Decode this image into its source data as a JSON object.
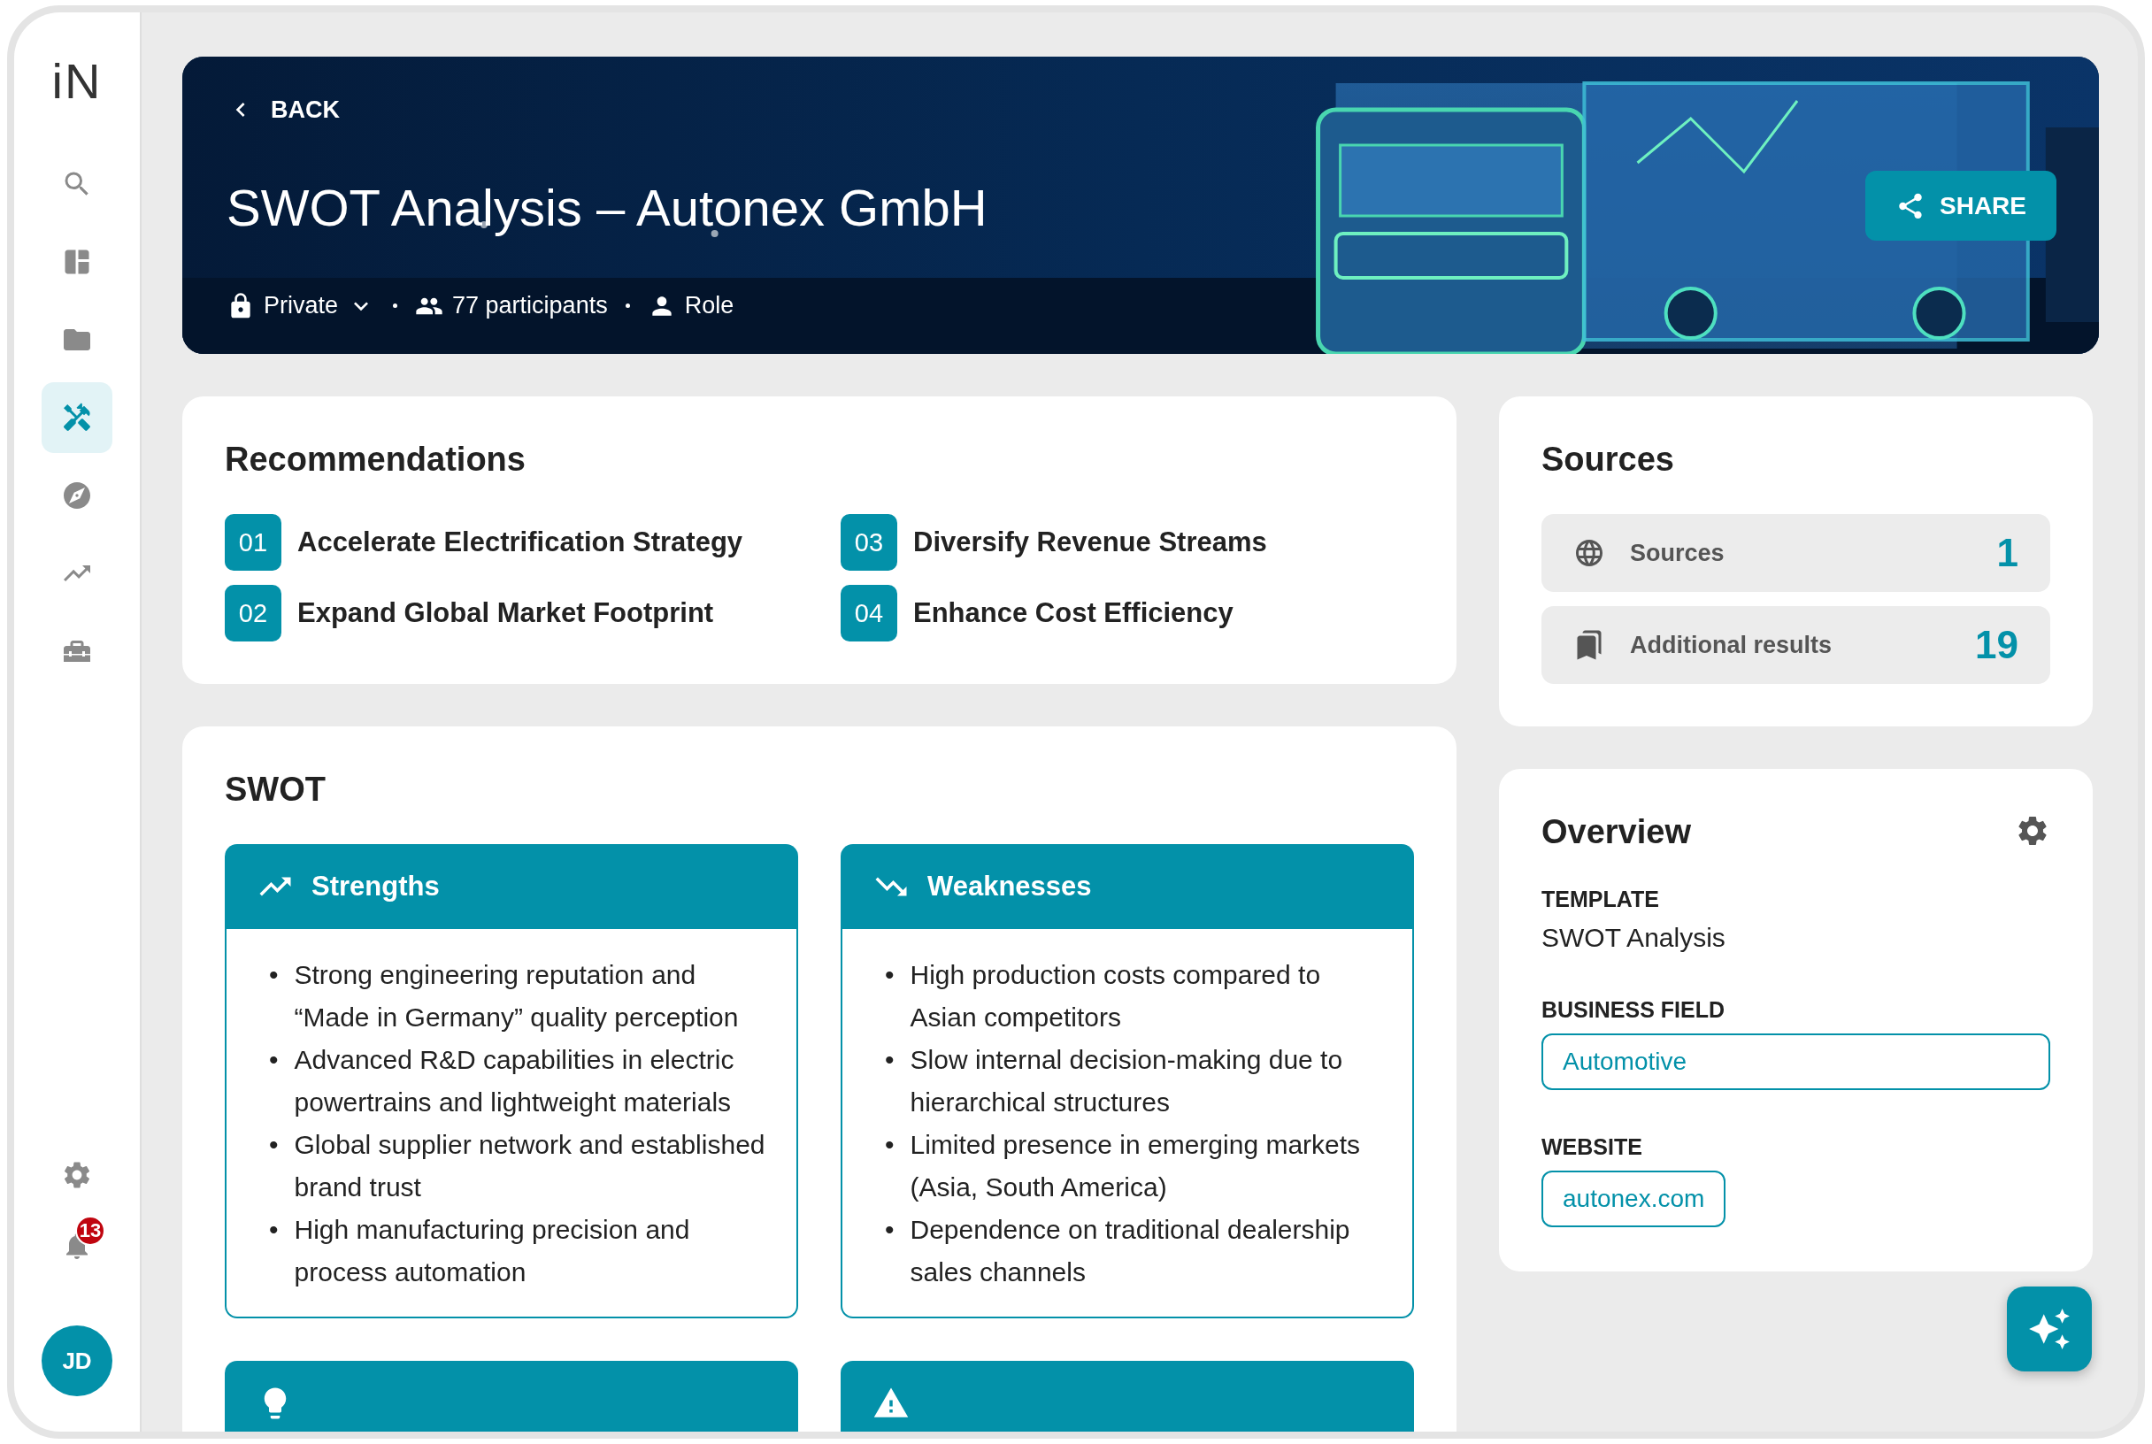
{
  "sidebar": {
    "logo": "iN",
    "nav": [
      {
        "kind": "search",
        "selected": false
      },
      {
        "kind": "dashboard",
        "selected": false
      },
      {
        "kind": "folder",
        "selected": false
      },
      {
        "kind": "tools",
        "selected": true
      },
      {
        "kind": "compass",
        "selected": false
      },
      {
        "kind": "trend",
        "selected": false
      },
      {
        "kind": "toolbox",
        "selected": false
      }
    ],
    "notifications": "13",
    "avatar": "JD"
  },
  "header": {
    "back": "BACK",
    "title": "SWOT Analysis – Autonex GmbH",
    "privacy": "Private",
    "participants": "77 participants",
    "role": "Role",
    "share": "SHARE"
  },
  "recommendations": {
    "title": "Recommendations",
    "items": [
      {
        "number": "01",
        "text": "Accelerate Electrification Strategy"
      },
      {
        "number": "02",
        "text": "Expand Global Market Footprint"
      },
      {
        "number": "03",
        "text": "Diversify Revenue Streams"
      },
      {
        "number": "04",
        "text": "Enhance Cost Efficiency"
      }
    ]
  },
  "swot": {
    "title": "SWOT",
    "bullet": "•",
    "quadrants": [
      {
        "kind": "up",
        "title": "Strengths",
        "points": [
          "Strong engineering reputation and “Made in Germany” quality perception",
          "Advanced R&D capabilities in electric powertrains and lightweight materials",
          "Global supplier network and established brand trust",
          "High manufacturing precision and process automation"
        ]
      },
      {
        "kind": "down",
        "title": "Weaknesses",
        "points": [
          "High production costs compared to Asian competitors",
          "Slow internal decision-making due to hierarchical structures",
          "Limited presence in emerging markets (Asia, South America)",
          "Dependence on traditional dealership sales channels"
        ]
      },
      {
        "kind": "bulb"
      },
      {
        "kind": "warning"
      }
    ]
  },
  "sources": {
    "title": "Sources",
    "rows": [
      {
        "kind": "web",
        "label": "Sources",
        "count": "1"
      },
      {
        "kind": "saved",
        "label": "Additional results",
        "count": "19"
      }
    ]
  },
  "overview": {
    "title": "Overview",
    "fields": [
      {
        "kind": "text",
        "label": "TEMPLATE",
        "value": "SWOT Analysis"
      },
      {
        "kind": "field",
        "label": "BUSINESS FIELD",
        "value": "Automotive"
      },
      {
        "kind": "link",
        "label": "WEBSITE",
        "value": "autonex.com"
      }
    ]
  }
}
